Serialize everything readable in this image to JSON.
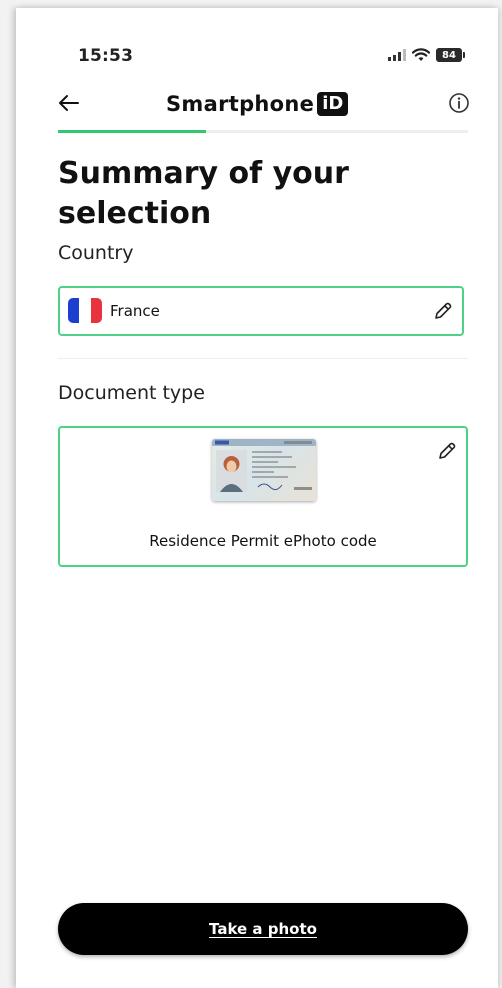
{
  "status_bar": {
    "time": "15:53",
    "battery_level": "84",
    "icons": [
      "signal-icon",
      "wifi-icon",
      "battery-icon"
    ]
  },
  "header": {
    "brand_name": "Smartphone",
    "brand_badge": "iD",
    "back_icon": "arrow-left-icon",
    "info_icon": "info-circle-icon",
    "progress_fraction": 0.36
  },
  "summary": {
    "title": "Summary of your selection",
    "country_label": "Country",
    "country_value": "France",
    "country_flag": "flag-fr-icon",
    "document_label": "Document type",
    "document_name": "Residence Permit ePhoto code",
    "edit_icon": "pencil-icon"
  },
  "actions": {
    "take_photo_label": "Take a photo"
  },
  "colors": {
    "accent": "#35c670",
    "border_accent": "#4fd088",
    "button_bg": "#000000",
    "flag_blue": "#1d3fcf",
    "flag_white": "#ffffff",
    "flag_red": "#e8323e"
  }
}
